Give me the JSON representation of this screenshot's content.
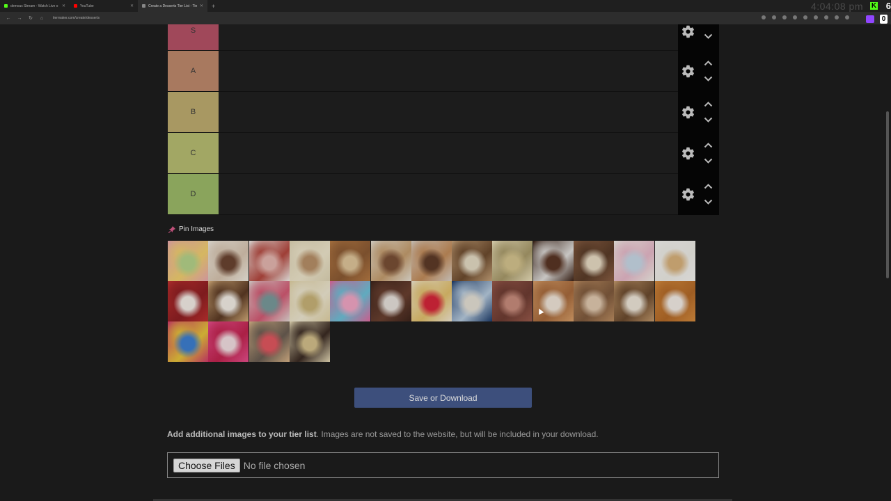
{
  "browser": {
    "tabs": [
      {
        "label": "demoux Stream - Watch Live o",
        "color": "#53fc18"
      },
      {
        "label": "YouTube",
        "color": "#ff0000"
      },
      {
        "label": "Create a Desserts Tier List - Tie",
        "color": "#888888"
      }
    ],
    "url": "tiermaker.com/create/desserts",
    "clock": "4:04:08 pm",
    "kick_count": "6",
    "twitch_count": "0"
  },
  "tiers": [
    {
      "label": "S",
      "color": "#a0485a"
    },
    {
      "label": "A",
      "color": "#a8795f"
    },
    {
      "label": "B",
      "color": "#a89862"
    },
    {
      "label": "C",
      "color": "#a2a764"
    },
    {
      "label": "D",
      "color": "#8aa45c"
    }
  ],
  "pin_images_label": "Pin Images",
  "images": [
    {
      "name": "macarons",
      "colors": [
        "#e9a8b0",
        "#b6d38b",
        "#f2d06f"
      ]
    },
    {
      "name": "layer-cake",
      "colors": [
        "#f1ece2",
        "#6b4431",
        "#d8c5b0"
      ]
    },
    {
      "name": "cupcake",
      "colors": [
        "#f4f0ec",
        "#e6b7b0",
        "#b4473e"
      ]
    },
    {
      "name": "cinnamon-rolls",
      "colors": [
        "#ded4b4",
        "#b89068",
        "#efe6cc"
      ]
    },
    {
      "name": "churros",
      "colors": [
        "#b77b45",
        "#e0c69b",
        "#8b5a33"
      ]
    },
    {
      "name": "crepes",
      "colors": [
        "#e8e2d6",
        "#7a4f35",
        "#c59d6e"
      ]
    },
    {
      "name": "donuts",
      "colors": [
        "#dcd3c9",
        "#5e3b28",
        "#c38c5a"
      ]
    },
    {
      "name": "cannoli",
      "colors": [
        "#c7a37a",
        "#e6dcc5",
        "#6d4b2e"
      ]
    },
    {
      "name": "cheesecake",
      "colors": [
        "#efe4c0",
        "#d6c58f",
        "#a89a6a"
      ]
    },
    {
      "name": "brownies",
      "colors": [
        "#3c2216",
        "#5a3524",
        "#e2e0dd"
      ]
    },
    {
      "name": "tiramisu",
      "colors": [
        "#8c6044",
        "#e9dcc5",
        "#5a3c28"
      ]
    },
    {
      "name": "funfetti-cake",
      "colors": [
        "#f2efe7",
        "#c9d9e7",
        "#e7b9c9"
      ]
    },
    {
      "name": "ice-cream-cones",
      "colors": [
        "#f5f4f1",
        "#d9b27c",
        "#eeece6"
      ]
    },
    {
      "name": "red-velvet-cake",
      "colors": [
        "#c0302f",
        "#f4ede7",
        "#8e1f22"
      ]
    },
    {
      "name": "smores",
      "colors": [
        "#d8b07c",
        "#f4efe7",
        "#5c3a24"
      ]
    },
    {
      "name": "frozen-yogurt",
      "colors": [
        "#e3d9d5",
        "#7a9b9c",
        "#d45a74"
      ]
    },
    {
      "name": "rice-krispie-treats",
      "colors": [
        "#e1d2a4",
        "#c9b478",
        "#efe8d2"
      ]
    },
    {
      "name": "pink-donut",
      "colors": [
        "#e56aa0",
        "#f2a7c6",
        "#6dc2d9"
      ]
    },
    {
      "name": "chocolate-mousse-cake",
      "colors": [
        "#3d241b",
        "#e8e2dc",
        "#6a4030"
      ]
    },
    {
      "name": "banana-split",
      "colors": [
        "#f2e8d2",
        "#d7253a",
        "#e2c06c"
      ]
    },
    {
      "name": "dippin-dots",
      "colors": [
        "#1d3c6b",
        "#e6e1d6",
        "#b8ccdf"
      ]
    },
    {
      "name": "fudge",
      "colors": [
        "#9b5b4c",
        "#c98d7d",
        "#6e3c32"
      ]
    },
    {
      "name": "apple-pie",
      "colors": [
        "#d9a06a",
        "#f1e6d9",
        "#a86a3c"
      ]
    },
    {
      "name": "cannoli-shells",
      "colors": [
        "#bd8e62",
        "#e2cab0",
        "#7f5a3d"
      ]
    },
    {
      "name": "cookies",
      "colors": [
        "#c49a6c",
        "#efe7d9",
        "#6b4a2e"
      ]
    },
    {
      "name": "pumpkin-pie",
      "colors": [
        "#d58b3e",
        "#f3ece5",
        "#b46a28"
      ]
    },
    {
      "name": "candy",
      "colors": [
        "#d13a6b",
        "#3d7fd1",
        "#e7c43a"
      ]
    },
    {
      "name": "sundae",
      "colors": [
        "#e84f8d",
        "#f3dfe2",
        "#c2244f"
      ]
    },
    {
      "name": "popsicles",
      "colors": [
        "#d9b488",
        "#e2575f",
        "#6a5d52"
      ]
    },
    {
      "name": "cookie-dough",
      "colors": [
        "#e8dcb8",
        "#d4c08c",
        "#3a2a22"
      ]
    }
  ],
  "save_button_label": "Save or Download",
  "add_images_bold": "Add additional images to your tier list",
  "add_images_rest": ". Images are not saved to the website, but will be included in your download.",
  "choose_files_label": "Choose Files",
  "no_file_label": "No file chosen"
}
